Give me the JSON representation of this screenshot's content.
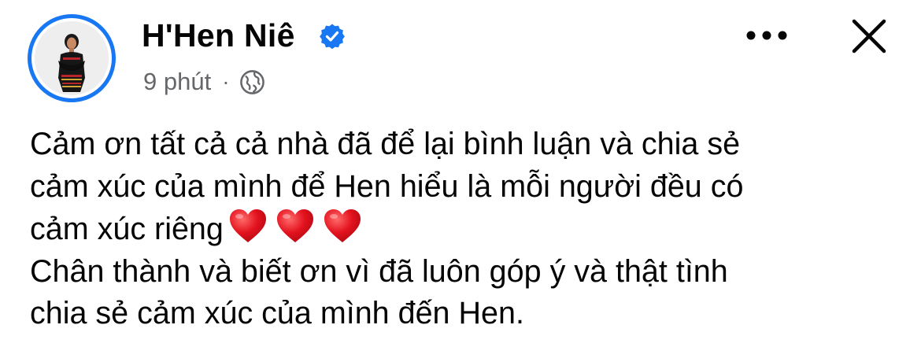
{
  "author": {
    "name": "H'Hen Niê",
    "verified": true,
    "avatar_icon": "profile-photo"
  },
  "meta": {
    "time": "9 phút",
    "separator": "·",
    "audience_icon": "globe-icon"
  },
  "actions": {
    "more_icon": "more-horizontal-icon",
    "close_icon": "close-icon"
  },
  "post": {
    "lines": [
      "Cảm ơn tất cả cả nhà đã để lại bình luận và chia sẻ",
      "cảm xúc của mình để Hen hiểu là mỗi người đều có",
      "cảm xúc riêng",
      "Chân thành và biết ơn vì đã luôn góp ý và thật tình",
      "chia sẻ cảm xúc của mình đến Hen."
    ],
    "emoji": [
      "red-heart",
      "red-heart",
      "red-heart"
    ]
  },
  "colors": {
    "accent": "#1877f2",
    "meta_text": "#65676b",
    "heart": "#e3121e"
  }
}
